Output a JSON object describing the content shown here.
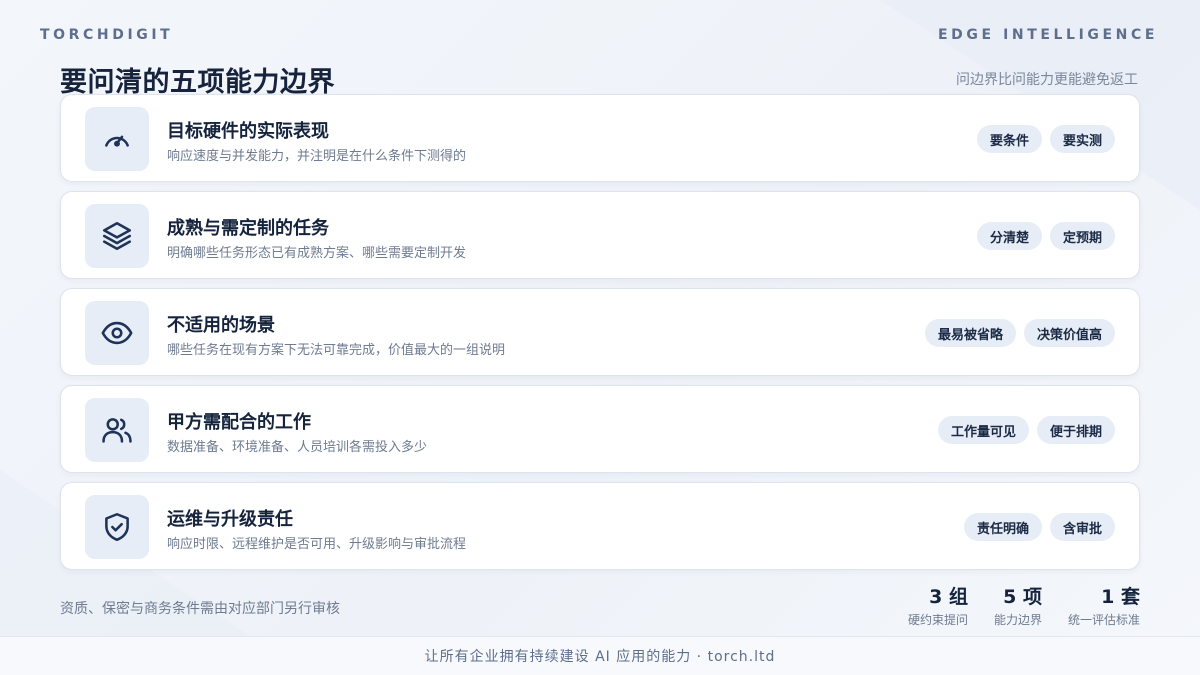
{
  "brand": {
    "left": "TORCHDIGIT",
    "right": "EDGE INTELLIGENCE"
  },
  "header": {
    "title": "要问清的五项能力边界",
    "subtitle": "问边界比问能力更能避免返工"
  },
  "cards": [
    {
      "icon": "gauge-icon",
      "title": "目标硬件的实际表现",
      "desc": "响应速度与并发能力，并注明是在什么条件下测得的",
      "tags": [
        "要条件",
        "要实测"
      ]
    },
    {
      "icon": "layers-icon",
      "title": "成熟与需定制的任务",
      "desc": "明确哪些任务形态已有成熟方案、哪些需要定制开发",
      "tags": [
        "分清楚",
        "定预期"
      ]
    },
    {
      "icon": "eye-icon",
      "title": "不适用的场景",
      "desc": "哪些任务在现有方案下无法可靠完成，价值最大的一组说明",
      "tags": [
        "最易被省略",
        "决策价值高"
      ]
    },
    {
      "icon": "users-icon",
      "title": "甲方需配合的工作",
      "desc": "数据准备、环境准备、人员培训各需投入多少",
      "tags": [
        "工作量可见",
        "便于排期"
      ]
    },
    {
      "icon": "shield-check-icon",
      "title": "运维与升级责任",
      "desc": "响应时限、远程维护是否可用、升级影响与审批流程",
      "tags": [
        "责任明确",
        "含审批"
      ]
    }
  ],
  "footnote": "资质、保密与商务条件需由对应部门另行审核",
  "stats": [
    {
      "value": "3 组",
      "label": "硬约束提问"
    },
    {
      "value": "5 项",
      "label": "能力边界"
    },
    {
      "value": "1 套",
      "label": "统一评估标准"
    }
  ],
  "footer": {
    "text": "让所有企业拥有持续建设 AI 应用的能力 · torch.ltd"
  },
  "colors": {
    "accent": "#1f3358",
    "icon_bg": "#e6edf6",
    "tag_bg": "#e7edf6",
    "text_muted": "#6e7b90"
  }
}
